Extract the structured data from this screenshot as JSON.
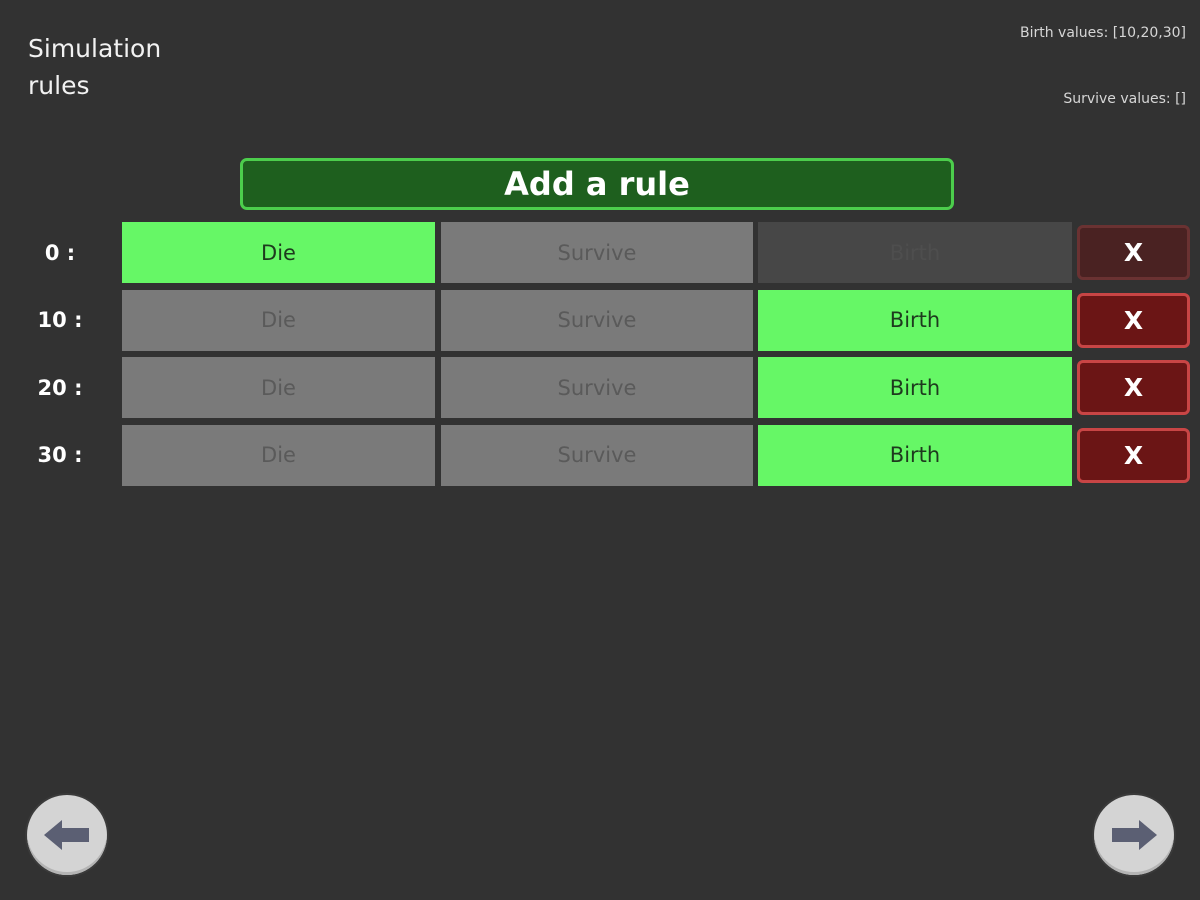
{
  "title": "Simulation rules",
  "info": {
    "birth_values": "Birth values: [10,20,30]",
    "survive_values": "Survive values: []"
  },
  "add_rule_label": "Add a rule",
  "rules": [
    {
      "label": "0 :",
      "die": "Die",
      "survive": "Survive",
      "birth": "Birth",
      "delete": "X",
      "state": "die"
    },
    {
      "label": "10 :",
      "die": "Die",
      "survive": "Survive",
      "birth": "Birth",
      "delete": "X",
      "state": "birth"
    },
    {
      "label": "20 :",
      "die": "Die",
      "survive": "Survive",
      "birth": "Birth",
      "delete": "X",
      "state": "birth"
    },
    {
      "label": "30 :",
      "die": "Die",
      "survive": "Survive",
      "birth": "Birth",
      "delete": "X",
      "state": "birth"
    }
  ],
  "icons": {
    "back": "arrow-left-icon",
    "forward": "arrow-right-icon"
  },
  "colors": {
    "background": "#323232",
    "active": "#66f766",
    "inactive": "#7a7a7a",
    "add_button": "#1e5f1e",
    "delete_button": "#6b1515"
  }
}
